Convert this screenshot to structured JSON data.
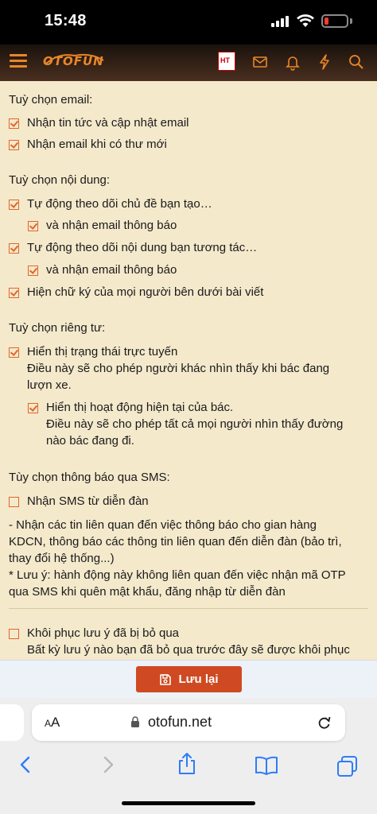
{
  "status_bar": {
    "time": "15:48",
    "battery_level": 0.12
  },
  "header": {
    "logo": "OTOFUN",
    "badge_text": "HT"
  },
  "email_options": {
    "title": "Tuỳ chọn email:",
    "items": [
      {
        "label": "Nhận tin tức và cập nhật email",
        "checked": true
      },
      {
        "label": "Nhận email khi có thư mới",
        "checked": true
      }
    ]
  },
  "content_options": {
    "title": "Tuỳ chọn nội dung:",
    "items": [
      {
        "label": "Tự động theo dõi chủ đề bạn tạo…",
        "checked": true
      },
      {
        "label": "và nhận email thông báo",
        "checked": true
      },
      {
        "label": "Tự động theo dõi nội dung bạn tương tác…",
        "checked": true
      },
      {
        "label": "và nhận email thông báo",
        "checked": true
      },
      {
        "label": "Hiện chữ ký của mọi người bên dưới bài viết",
        "checked": true
      }
    ]
  },
  "privacy_options": {
    "title": "Tuỳ chọn riêng tư:",
    "items": [
      {
        "label": "Hiển thị trạng thái trực tuyến",
        "desc_line1": "Điều này sẽ cho phép người khác nhìn thấy khi bác đang",
        "desc_line2": "lượn xe.",
        "checked": true
      },
      {
        "label": "Hiển thị hoạt động hiện tại của bác.",
        "desc_line1": "Điều này sẽ cho phép tất cả mọi người nhìn thấy đường",
        "desc_line2": "nào bác đang đi.",
        "checked": true
      }
    ]
  },
  "sms_options": {
    "title": "Tùy chọn thông báo qua SMS:",
    "item": {
      "label": "Nhận SMS từ diễn đàn",
      "checked": false
    },
    "note_lines": [
      "- Nhận các tin liên quan đến việc thông báo cho gian hàng",
      "KDCN, thông báo các thông tin liên quan đến diễn đàn (bảo trì,",
      "thay đổi hệ thống...)",
      "* Lưu ý: hành động này không liên quan đến việc nhận mã OTP",
      "qua SMS khi quên mật khẩu, đăng nhập từ diễn đàn"
    ]
  },
  "restore": {
    "label": "Khôi phục lưu ý đã bị bỏ qua",
    "desc": "Bất kỳ lưu ý nào bạn đã bỏ qua trước đây sẽ được khôi phục",
    "checked": false
  },
  "save_button": {
    "label": "Lưu lại"
  },
  "browser": {
    "aa_small": "A",
    "aa_big": "A",
    "url": "otofun.net"
  },
  "colors": {
    "accent": "#e0662a",
    "save": "#cf4a22",
    "page_bg": "#f5e9cc"
  }
}
